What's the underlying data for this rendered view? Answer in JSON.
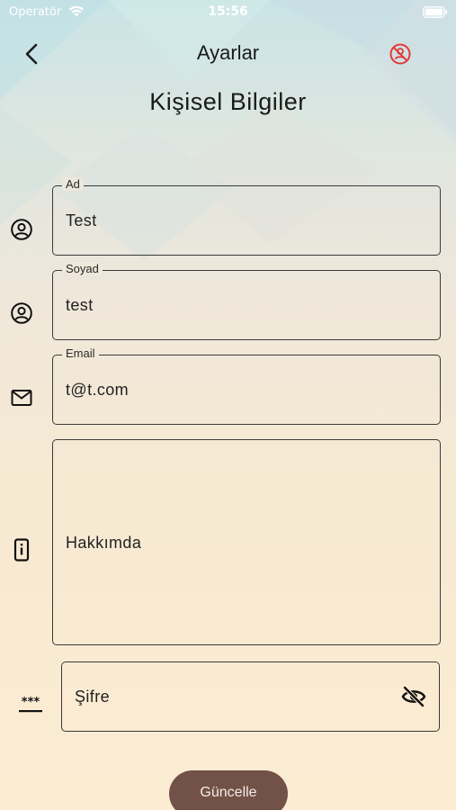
{
  "status_bar": {
    "carrier": "Operatör",
    "time": "15:56"
  },
  "nav": {
    "title": "Ayarlar"
  },
  "section_title": "Kişisel Bilgiler",
  "fields": {
    "first_name": {
      "label": "Ad",
      "value": "Test"
    },
    "last_name": {
      "label": "Soyad",
      "value": "test"
    },
    "email": {
      "label": "Email",
      "value": "t@t.com"
    },
    "about": {
      "placeholder": "Hakkımda"
    },
    "password": {
      "placeholder": "Şifre"
    }
  },
  "update_button": {
    "label": "Güncelle"
  },
  "icons": {
    "back": "chevron-left-icon",
    "nav_action": "no-account-icon",
    "first_name": "account-circle-icon",
    "last_name": "account-circle-icon",
    "email": "mail-icon",
    "about": "info-icon",
    "password": "password-icon",
    "password_toggle": "eye-off-icon"
  },
  "colors": {
    "accent_red": "#e53935",
    "button_bg": "#725248",
    "outline": "#3a3a3a"
  }
}
